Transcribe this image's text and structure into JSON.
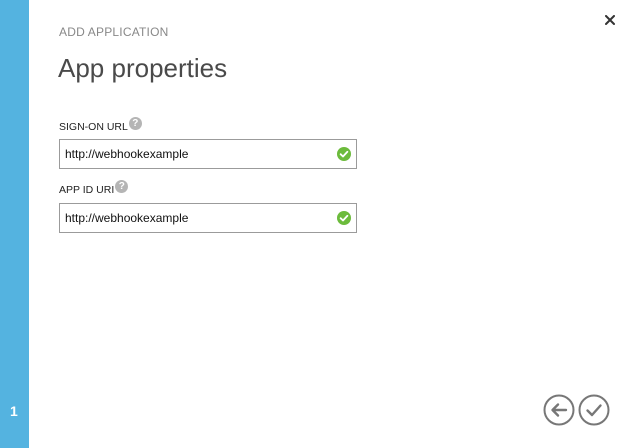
{
  "wizard": {
    "breadcrumb": "ADD APPLICATION",
    "title": "App properties",
    "step": "1"
  },
  "fields": {
    "sign_on_url": {
      "label": "SIGN-ON URL",
      "value": "http://webhookexample"
    },
    "app_id_uri": {
      "label": "APP ID URI",
      "value": "http://webhookexample"
    }
  },
  "icons": {
    "help": "?",
    "valid": "checkmark-circle-icon",
    "close": "close-icon",
    "back": "arrow-left-icon",
    "complete": "checkmark-icon"
  },
  "colors": {
    "accent": "#54b3e0",
    "valid": "#6cbb3c",
    "nav_icon": "#777777"
  }
}
